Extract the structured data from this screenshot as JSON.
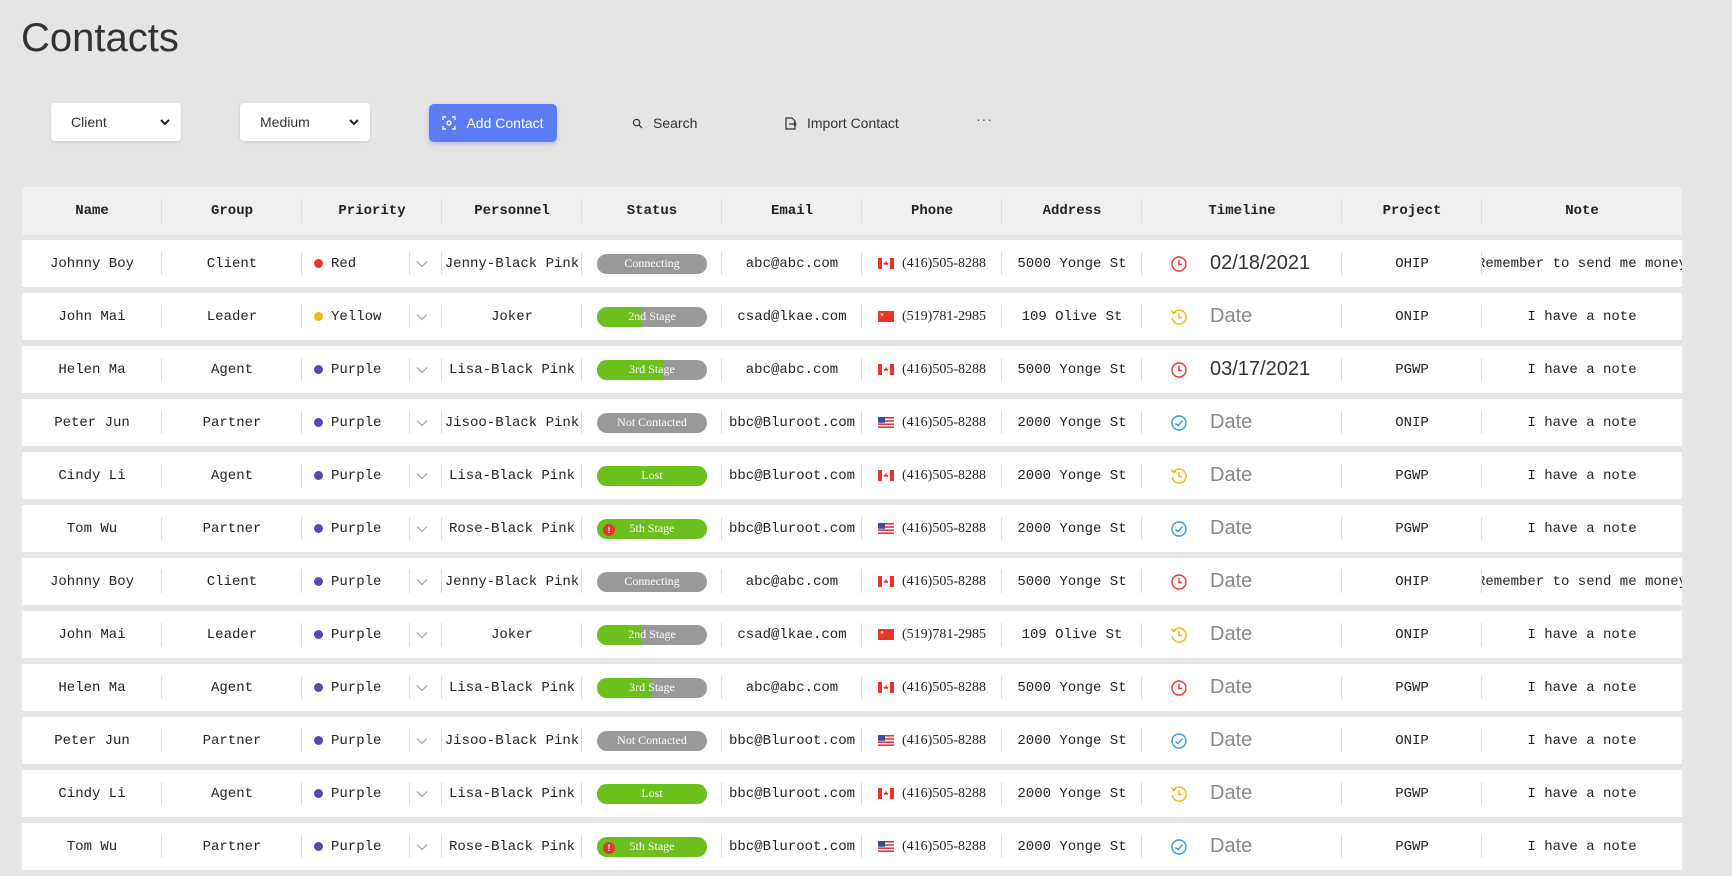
{
  "page": {
    "title": "Contacts"
  },
  "toolbar": {
    "group_select": "Client",
    "priority_select": "Medium",
    "add_label": "Add Contact",
    "search_label": "Search",
    "import_label": "Import Contact",
    "more_label": "···"
  },
  "colors": {
    "accent": "#5b7cf5",
    "status_green": "#6cc01e",
    "status_gray": "#999999",
    "red": "#e8342c",
    "yellow": "#f2b611",
    "purple": "#5a46b4",
    "blue": "#3a9ae0"
  },
  "table": {
    "headers": [
      "Name",
      "Group",
      "Priority",
      "Personnel",
      "Status",
      "Email",
      "Phone",
      "Address",
      "Timeline",
      "Project",
      "Note"
    ],
    "rows": [
      {
        "name": "Johnny Boy",
        "group": "Client",
        "priority": "Red",
        "priority_color": "#e8342c",
        "personnel": "Jenny-Black Pink",
        "status": "Connecting",
        "status_progress": 0,
        "status_alert": false,
        "email": "abc@abc.com",
        "flag": "ca",
        "phone": "(416)505-8288",
        "address": "5000 Yonge St",
        "timeline_icon": "alarm-clock-red",
        "timeline": "02/18/2021",
        "timeline_set": true,
        "project": "OHIP",
        "note": "Remember to send me money"
      },
      {
        "name": "John Mai",
        "group": "Leader",
        "priority": "Yellow",
        "priority_color": "#f2b611",
        "personnel": "Joker",
        "status": "2nd Stage",
        "status_progress": 0.4,
        "status_alert": false,
        "email": "csad@lkae.com",
        "flag": "cn",
        "phone": "(519)781-2985",
        "address": "109 Olive St",
        "timeline_icon": "history-yellow",
        "timeline": "Date",
        "timeline_set": false,
        "project": "ONIP",
        "note": "I have a note"
      },
      {
        "name": "Helen Ma",
        "group": "Agent",
        "priority": "Purple",
        "priority_color": "#5a46b4",
        "personnel": "Lisa-Black Pink",
        "status": "3rd Stage",
        "status_progress": 0.6,
        "status_alert": false,
        "email": "abc@abc.com",
        "flag": "ca",
        "phone": "(416)505-8288",
        "address": "5000 Yonge St",
        "timeline_icon": "alarm-clock-red",
        "timeline": "03/17/2021",
        "timeline_set": true,
        "project": "PGWP",
        "note": "I have a note"
      },
      {
        "name": "Peter Jun",
        "group": "Partner",
        "priority": "Purple",
        "priority_color": "#5a46b4",
        "personnel": "Jisoo-Black Pink",
        "status": "Not Contacted",
        "status_progress": 0,
        "status_alert": false,
        "email": "bbc@Bluroot.com",
        "flag": "us",
        "phone": "(416)505-8288",
        "address": "2000 Yonge St",
        "timeline_icon": "check-circle-blue",
        "timeline": "Date",
        "timeline_set": false,
        "project": "ONIP",
        "note": "I have a note"
      },
      {
        "name": "Cindy Li",
        "group": "Agent",
        "priority": "Purple",
        "priority_color": "#5a46b4",
        "personnel": "Lisa-Black Pink",
        "status": "Lost",
        "status_progress": 1,
        "status_alert": false,
        "email": "bbc@Bluroot.com",
        "flag": "ca",
        "phone": "(416)505-8288",
        "address": "2000 Yonge St",
        "timeline_icon": "history-yellow",
        "timeline": "Date",
        "timeline_set": false,
        "project": "PGWP",
        "note": "I have a note"
      },
      {
        "name": "Tom Wu",
        "group": "Partner",
        "priority": "Purple",
        "priority_color": "#5a46b4",
        "personnel": "Rose-Black Pink",
        "status": "5th Stage",
        "status_progress": 1,
        "status_alert": true,
        "email": "bbc@Bluroot.com",
        "flag": "us",
        "phone": "(416)505-8288",
        "address": "2000 Yonge St",
        "timeline_icon": "check-circle-blue",
        "timeline": "Date",
        "timeline_set": false,
        "project": "PGWP",
        "note": "I have a note"
      },
      {
        "name": "Johnny Boy",
        "group": "Client",
        "priority": "Purple",
        "priority_color": "#5a46b4",
        "personnel": "Jenny-Black Pink",
        "status": "Connecting",
        "status_progress": 0,
        "status_alert": false,
        "email": "abc@abc.com",
        "flag": "ca",
        "phone": "(416)505-8288",
        "address": "5000 Yonge St",
        "timeline_icon": "alarm-clock-red",
        "timeline": "Date",
        "timeline_set": false,
        "project": "OHIP",
        "note": "Remember to send me money"
      },
      {
        "name": "John Mai",
        "group": "Leader",
        "priority": "Purple",
        "priority_color": "#5a46b4",
        "personnel": "Joker",
        "status": "2nd Stage",
        "status_progress": 0.4,
        "status_alert": false,
        "email": "csad@lkae.com",
        "flag": "cn",
        "phone": "(519)781-2985",
        "address": "109 Olive St",
        "timeline_icon": "history-yellow",
        "timeline": "Date",
        "timeline_set": false,
        "project": "ONIP",
        "note": "I have a note"
      },
      {
        "name": "Helen Ma",
        "group": "Agent",
        "priority": "Purple",
        "priority_color": "#5a46b4",
        "personnel": "Lisa-Black Pink",
        "status": "3rd Stage",
        "status_progress": 0.5,
        "status_alert": false,
        "email": "abc@abc.com",
        "flag": "ca",
        "phone": "(416)505-8288",
        "address": "5000 Yonge St",
        "timeline_icon": "alarm-clock-red",
        "timeline": "Date",
        "timeline_set": false,
        "project": "PGWP",
        "note": "I have a note"
      },
      {
        "name": "Peter Jun",
        "group": "Partner",
        "priority": "Purple",
        "priority_color": "#5a46b4",
        "personnel": "Jisoo-Black Pink",
        "status": "Not Contacted",
        "status_progress": 0,
        "status_alert": false,
        "email": "bbc@Bluroot.com",
        "flag": "us",
        "phone": "(416)505-8288",
        "address": "2000 Yonge St",
        "timeline_icon": "check-circle-blue",
        "timeline": "Date",
        "timeline_set": false,
        "project": "ONIP",
        "note": "I have a note"
      },
      {
        "name": "Cindy Li",
        "group": "Agent",
        "priority": "Purple",
        "priority_color": "#5a46b4",
        "personnel": "Lisa-Black Pink",
        "status": "Lost",
        "status_progress": 1,
        "status_alert": false,
        "email": "bbc@Bluroot.com",
        "flag": "ca",
        "phone": "(416)505-8288",
        "address": "2000 Yonge St",
        "timeline_icon": "history-yellow",
        "timeline": "Date",
        "timeline_set": false,
        "project": "PGWP",
        "note": "I have a note"
      },
      {
        "name": "Tom Wu",
        "group": "Partner",
        "priority": "Purple",
        "priority_color": "#5a46b4",
        "personnel": "Rose-Black Pink",
        "status": "5th Stage",
        "status_progress": 1,
        "status_alert": true,
        "email": "bbc@Bluroot.com",
        "flag": "us",
        "phone": "(416)505-8288",
        "address": "2000 Yonge St",
        "timeline_icon": "check-circle-blue",
        "timeline": "Date",
        "timeline_set": false,
        "project": "PGWP",
        "note": "I have a note"
      }
    ]
  }
}
